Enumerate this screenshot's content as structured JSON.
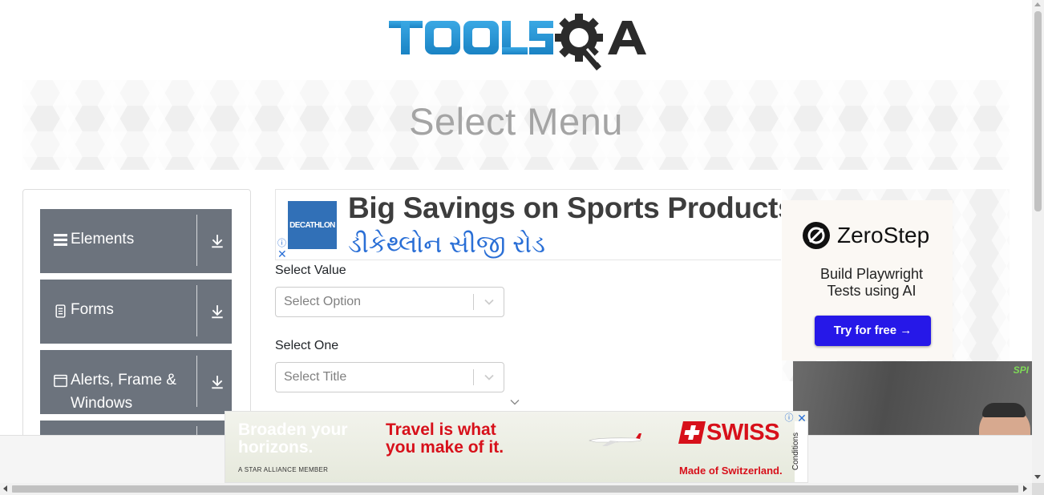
{
  "header": {
    "logo_text": "TOOLSQA"
  },
  "banner": {
    "title": "Select Menu"
  },
  "sidebar": {
    "groups": [
      {
        "label": "Elements",
        "icon": "hamburger-icon"
      },
      {
        "label": "Forms",
        "icon": "document-icon"
      },
      {
        "label": "Alerts, Frame & Windows",
        "icon": "window-icon"
      }
    ]
  },
  "ad_top": {
    "brand": "DECATHLON",
    "headline": "Big Savings on Sports Products",
    "subline": "ડીકેથ્લોન સીજી રોડ",
    "adchoices_icon": "ⓘ",
    "close_icon": "✕"
  },
  "form": {
    "select_value": {
      "label": "Select Value",
      "placeholder": "Select Option"
    },
    "select_one": {
      "label": "Select One",
      "placeholder": "Select Title"
    }
  },
  "ad_right": {
    "brand": "ZeroStep",
    "tagline_line1": "Build Playwright",
    "tagline_line2": "Tests using AI",
    "cta": "Try for free →"
  },
  "ad_bottom": {
    "line1a": "Broaden your",
    "line1b": "horizons.",
    "line2a": "Travel is what",
    "line2b": "you make of it.",
    "alliance": "A STAR ALLIANCE MEMBER",
    "brand": "SWISS",
    "made": "Made of Switzerland.",
    "conditions": "Conditions",
    "adchoices_icon": "ⓘ",
    "close_icon": "✕"
  },
  "video": {
    "brand": "SPI"
  },
  "colors": {
    "accent_blue": "#1f9bd8",
    "sidebar_group": "#6c737d",
    "swiss_red": "#d7101a",
    "zerostep_button": "#2618e8"
  }
}
